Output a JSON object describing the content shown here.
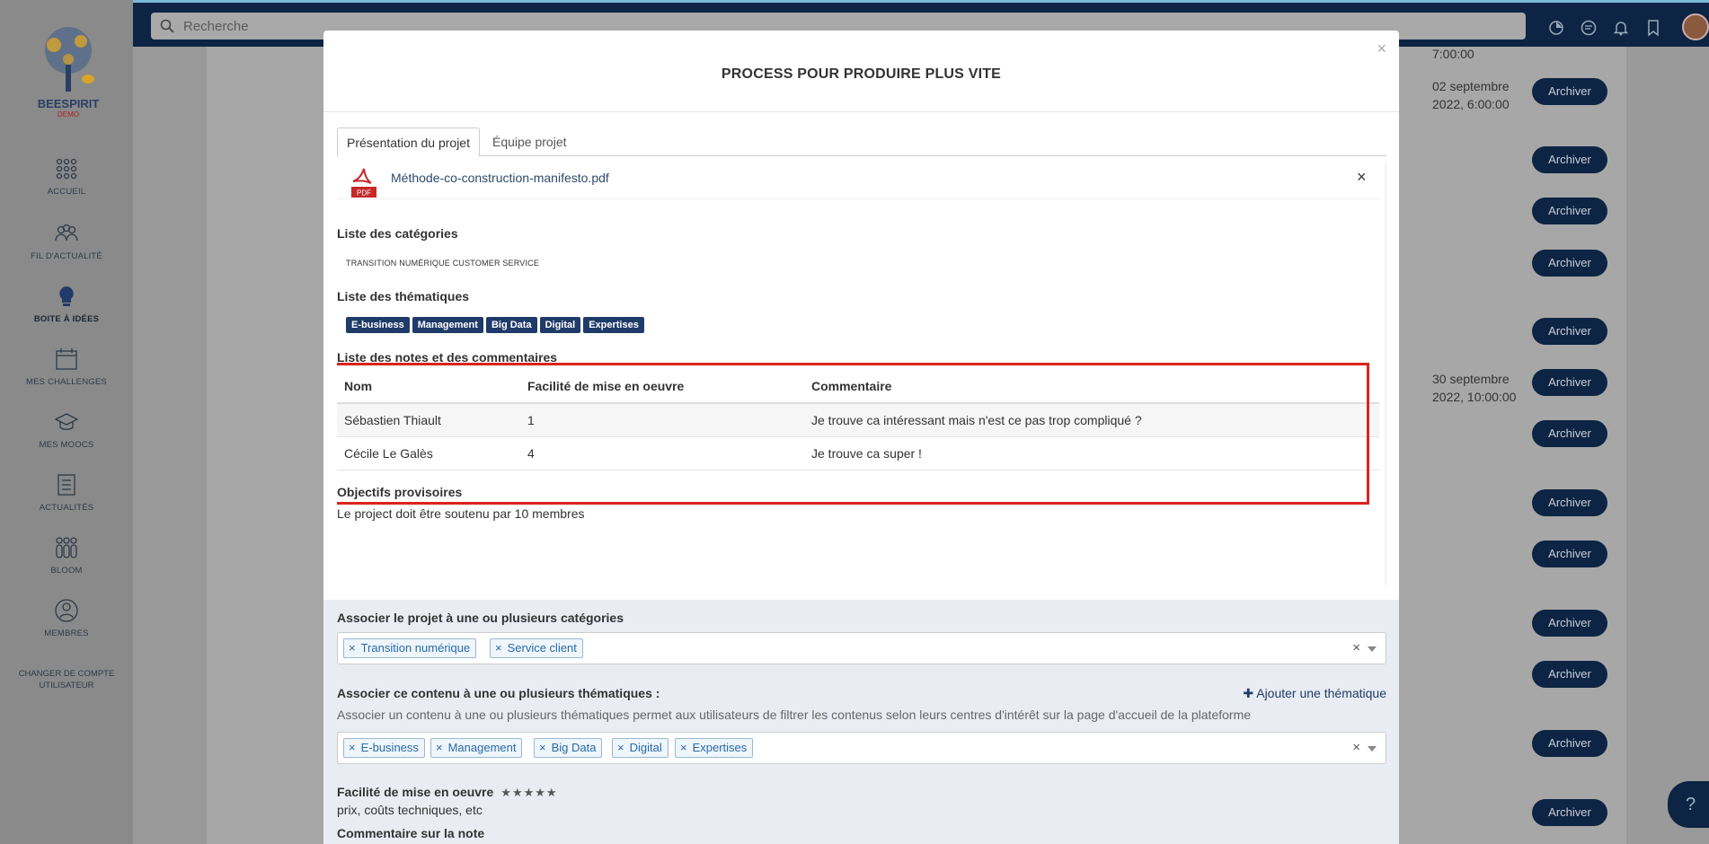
{
  "app": {
    "logo_text": "BEESPIRIT",
    "logo_subtext": "DEMO"
  },
  "sidebar": {
    "items": [
      {
        "label": "ACCUEIL",
        "icon": "grid-dots-icon"
      },
      {
        "label": "FIL D'ACTUALITÉ",
        "icon": "people-icon"
      },
      {
        "label": "BOITE À IDÉES",
        "icon": "lightbulb-icon"
      },
      {
        "label": "MES CHALLENGES",
        "icon": "calendar-icon"
      },
      {
        "label": "MES MOOCS",
        "icon": "graduation-cap-icon"
      },
      {
        "label": "ACTUALITÉS",
        "icon": "document-icon"
      },
      {
        "label": "BLOOM",
        "icon": "group-icon"
      },
      {
        "label": "MEMBRES",
        "icon": "user-icon"
      }
    ],
    "switch_account": "CHANGER DE COMPTE UTILISATEUR"
  },
  "topbar": {
    "search_placeholder": "Recherche"
  },
  "background": {
    "dates": [
      {
        "line1": "7:00:00",
        "line2": ""
      },
      {
        "line1": "02 septembre",
        "line2": "2022, 6:00:00"
      },
      {
        "line1": "30 septembre",
        "line2": "2022, 10:00:00"
      }
    ],
    "archive_label": "Archiver"
  },
  "modal": {
    "title": "PROCESS POUR PRODUIRE PLUS VITE",
    "tabs": [
      "Présentation du projet",
      "Équipe projet"
    ],
    "attachment": "Méthode-co-construction-manifesto.pdf",
    "attachment_icon_text": "PDF",
    "categories_title": "Liste des catégories",
    "categories_text": "TRANSITION NUMÉRIQUE  CUSTOMER SERVICE",
    "themes_title": "Liste des thématiques",
    "themes": [
      "E-business",
      "Management",
      "Big Data",
      "Digital",
      "Expertises"
    ],
    "notes_title": "Liste des notes et des commentaires",
    "notes_headers": [
      "Nom",
      "Facilité de mise en oeuvre",
      "Commentaire"
    ],
    "notes_rows": [
      {
        "name": "Sébastien Thiault",
        "score": "1",
        "comment": "Je trouve ca intéressant mais n'est ce pas trop compliqué ?"
      },
      {
        "name": "Cécile Le Galès",
        "score": "4",
        "comment": "Je trouve ca super !"
      }
    ],
    "objectives_title": "Objectifs provisoires",
    "objectives_text": "Le project doit être soutenu par 10 membres"
  },
  "form": {
    "cat_label": "Associer le projet à une ou plusieurs catégories",
    "cat_chips": [
      "Transition numérique",
      "Service client"
    ],
    "theme_label": "Associer ce contenu à une ou plusieurs thématiques :",
    "add_theme": "Ajouter une thématique",
    "theme_help": "Associer un contenu à une ou plusieurs thématiques permet aux utilisateurs de filtrer les contenus selon leurs centres d'intérêt sur la page d'accueil de la plateforme",
    "theme_chips": [
      "E-business",
      "Management",
      "Big Data",
      "Digital",
      "Expertises"
    ],
    "ease_label": "Facilité de mise en oeuvre",
    "ease_stars": "★★★★★",
    "ease_help": "prix, coûts techniques, etc",
    "comment_label": "Commentaire sur la note"
  },
  "help_label": "?"
}
